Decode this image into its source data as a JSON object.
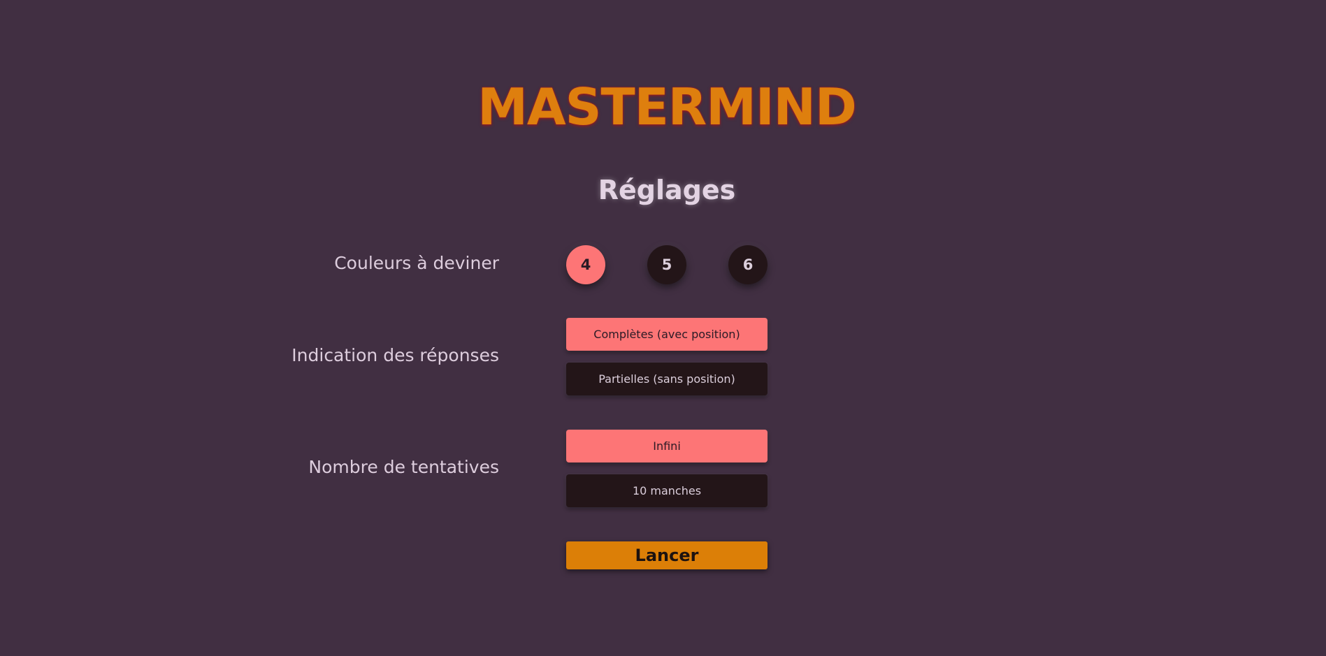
{
  "app": {
    "title": "MASTERMIND",
    "subtitle": "Réglages"
  },
  "colors": {
    "background": "#412f42",
    "title": "#de7f0e",
    "selected": "#fd7576",
    "unselected": "#231518",
    "launch": "#dc7f07"
  },
  "settings": {
    "colors_to_guess": {
      "label": "Couleurs à deviner",
      "options": [
        "4",
        "5",
        "6"
      ],
      "selected": "4"
    },
    "answer_hints": {
      "label": "Indication des réponses",
      "options": [
        "Complètes (avec position)",
        "Partielles (sans position)"
      ],
      "selected": "Complètes (avec position)"
    },
    "attempts": {
      "label": "Nombre de tentatives",
      "options": [
        "Infini",
        "10 manches"
      ],
      "selected": "Infini"
    }
  },
  "launch": {
    "label": "Lancer"
  }
}
